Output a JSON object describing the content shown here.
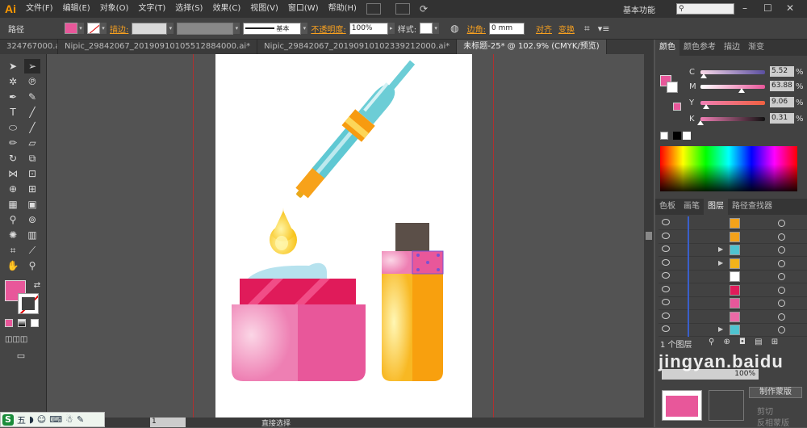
{
  "app": {
    "logo": "Ai",
    "workspace": "基本功能"
  },
  "menu": [
    "文件(F)",
    "编辑(E)",
    "对象(O)",
    "文字(T)",
    "选择(S)",
    "效果(C)",
    "视图(V)",
    "窗口(W)",
    "帮助(H)"
  ],
  "control": {
    "selection": "路径",
    "stroke_label": "描边:",
    "stroke_style": "基本",
    "opacity_label": "不透明度:",
    "opacity_value": "100%",
    "style_label": "样式:",
    "corner_label": "边角:",
    "corner_value": "0 mm",
    "align_label": "对齐",
    "transform_label": "变换"
  },
  "tabs": [
    "324767000.ai*",
    "Nipic_29842067_20190910105512884000.ai*",
    "Nipic_29842067_20190910102339212000.ai*",
    "未标题-25* @ 102.9% (CMYK/预览)"
  ],
  "color_panel": {
    "tabs": [
      "颜色",
      "颜色参考",
      "描边",
      "渐变"
    ],
    "channels": [
      {
        "name": "C",
        "value": "5.52",
        "unit": "%",
        "level": 0.055
      },
      {
        "name": "M",
        "value": "63.88",
        "unit": "%",
        "level": 0.639
      },
      {
        "name": "Y",
        "value": "9.06",
        "unit": "%",
        "level": 0.091
      },
      {
        "name": "K",
        "value": "0.31",
        "unit": "%",
        "level": 0.003
      }
    ],
    "fill_color": "#e8579a"
  },
  "layers_panel": {
    "tabs": [
      "色板",
      "画笔",
      "图层",
      "路径查找器"
    ],
    "count": "1 个图层",
    "rows": [
      {
        "thumb": "#f4a21a",
        "expand": false
      },
      {
        "thumb": "#f4a21a",
        "expand": false
      },
      {
        "thumb": "#4fc3cf",
        "expand": true
      },
      {
        "thumb": "#f2b21a",
        "expand": true
      },
      {
        "thumb": "#ffffff",
        "expand": false
      },
      {
        "thumb": "#e01b5a",
        "expand": false
      },
      {
        "thumb": "#e8579a",
        "expand": false
      },
      {
        "thumb": "#ec6aa6",
        "expand": false
      },
      {
        "thumb": "#4fc3cf",
        "expand": true
      }
    ]
  },
  "transparency": {
    "opacity": "100%",
    "make_mask": "制作蒙版",
    "clip": "剪切",
    "invert_mask": "反相蒙版"
  },
  "watermark": "jingyan.baidu",
  "status": {
    "zoom": "1",
    "tool": "直接选择"
  },
  "taskbar": {
    "label": "五"
  }
}
